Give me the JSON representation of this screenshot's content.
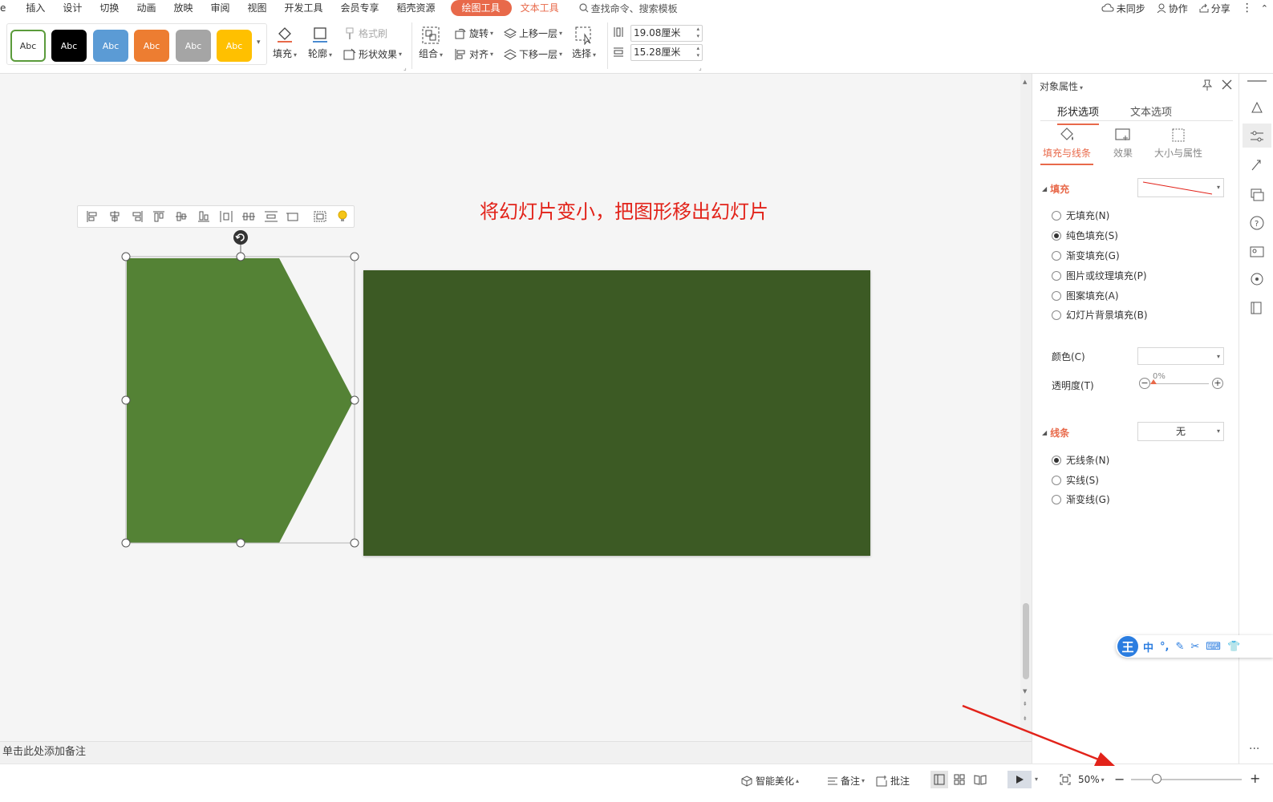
{
  "menu": {
    "items": [
      "插入",
      "设计",
      "切换",
      "动画",
      "放映",
      "审阅",
      "视图",
      "开发工具",
      "会员专享",
      "稻壳资源"
    ],
    "first_partial": "e",
    "active_tab": "绘图工具",
    "text_tool": "文本工具",
    "search_placeholder": "查找命令、搜索模板"
  },
  "topright": {
    "sync": "未同步",
    "collab": "协作",
    "share": "分享"
  },
  "ribbon": {
    "style_swatches": [
      {
        "label": "Abc",
        "bg": "#ffffff",
        "fg": "#333333",
        "border": "#5b9b3b"
      },
      {
        "label": "Abc",
        "bg": "#000000",
        "fg": "#ffffff",
        "border": "#000000"
      },
      {
        "label": "Abc",
        "bg": "#5b9bd5",
        "fg": "#ffffff",
        "border": "#5b9bd5"
      },
      {
        "label": "Abc",
        "bg": "#ed7d31",
        "fg": "#ffffff",
        "border": "#ed7d31"
      },
      {
        "label": "Abc",
        "bg": "#a5a5a5",
        "fg": "#ffffff",
        "border": "#a5a5a5"
      },
      {
        "label": "Abc",
        "bg": "#ffc000",
        "fg": "#ffffff",
        "border": "#ffc000"
      }
    ],
    "fill": "填充",
    "outline": "轮廓",
    "format_painter": "格式刷",
    "shape_effect": "形状效果",
    "group": "组合",
    "rotate": "旋转",
    "align": "对齐",
    "bring_forward": "上移一层",
    "send_backward": "下移一层",
    "select": "选择",
    "width": "19.08厘米",
    "height": "15.28厘米"
  },
  "canvas": {
    "hint_text": "将幻灯片变小，把图形移出幻灯片",
    "hint_color": "#e2231a",
    "pentagon_color": "#548235",
    "slide_color": "#3c5a24"
  },
  "notes_placeholder": "单击此处添加备注",
  "status": {
    "beautify": "智能美化",
    "notes": "备注",
    "comment": "批注",
    "zoom": "50%"
  },
  "panel": {
    "title": "对象属性",
    "tab_shape": "形状选项",
    "tab_text": "文本选项",
    "sub_fill_line": "填充与线条",
    "sub_effect": "效果",
    "sub_size": "大小与属性",
    "fill_section": "填充",
    "fill_options": [
      "无填充(N)",
      "纯色填充(S)",
      "渐变填充(G)",
      "图片或纹理填充(P)",
      "图案填充(A)",
      "幻灯片背景填充(B)"
    ],
    "fill_selected": 1,
    "color_label": "颜色(C)",
    "transparency_label": "透明度(T)",
    "transparency_value": "0%",
    "line_section": "线条",
    "line_dropdown": "无",
    "line_options": [
      "无线条(N)",
      "实线(S)",
      "渐变线(G)"
    ],
    "line_selected": 0
  },
  "ime": {
    "logo": "王",
    "mode": "中"
  },
  "accent": "#e8694a"
}
